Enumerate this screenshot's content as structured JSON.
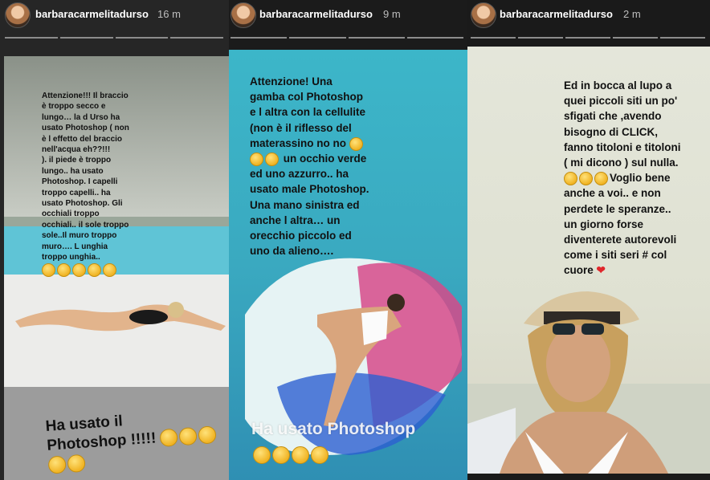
{
  "stories": [
    {
      "username": "barbaracarmelitadurso",
      "time": "16 m",
      "caption_lines": [
        "Attenzione!!! Il braccio",
        "è troppo secco e",
        "lungo… la d Urso ha",
        "usato Photoshop ( non",
        "è l effetto del braccio",
        "nell'acqua eh??!!!",
        "). il piede è troppo",
        "lungo.. ha usato",
        "Photoshop. I capelli",
        "troppo capelli.. ha",
        "usato Photoshop. Gli",
        "occhiali troppo",
        "occhiali.. il sole troppo",
        "sole..Il muro troppo",
        "muro…. L unghia",
        "troppo unghia.."
      ],
      "bottom_line1": "Ha usato il",
      "bottom_line2": "Photoshop !!!!!"
    },
    {
      "username": "barbaracarmelitadurso",
      "time": "9 m",
      "caption_lines": [
        "Attenzione! Una",
        "gamba col Photoshop",
        "e l altra con la cellulite",
        "(non è il riflesso del",
        "materassino no no",
        "un occhio verde",
        "ed uno azzurro.. ha",
        "usato male Photoshop.",
        "Una mano sinistra ed",
        "anche l altra… un",
        "orecchio piccolo ed",
        "uno da alieno…."
      ],
      "bottom_text": "Ha usato Photoshop"
    },
    {
      "username": "barbaracarmelitadurso",
      "time": "2 m",
      "dots": "•••",
      "caption_lines": [
        "Ed in bocca al lupo a",
        "quei piccoli siti un po'",
        "sfigati che ,avendo",
        "bisogno di CLICK,",
        "fanno titoloni e titoloni",
        "( mi dicono ) sul nulla.",
        "Voglio bene",
        "anche a voi.. e non",
        "perdete le speranze..",
        "un giorno forse",
        "diventerete autorevoli",
        "come i siti seri # col",
        "cuore"
      ]
    }
  ],
  "colors": {
    "pool": "#3fb6c8",
    "heart": "#e0262b",
    "emoji": "#f5c430"
  },
  "icons": {
    "emoji": "rofl-emoji-icon",
    "heart": "red-heart-icon"
  }
}
